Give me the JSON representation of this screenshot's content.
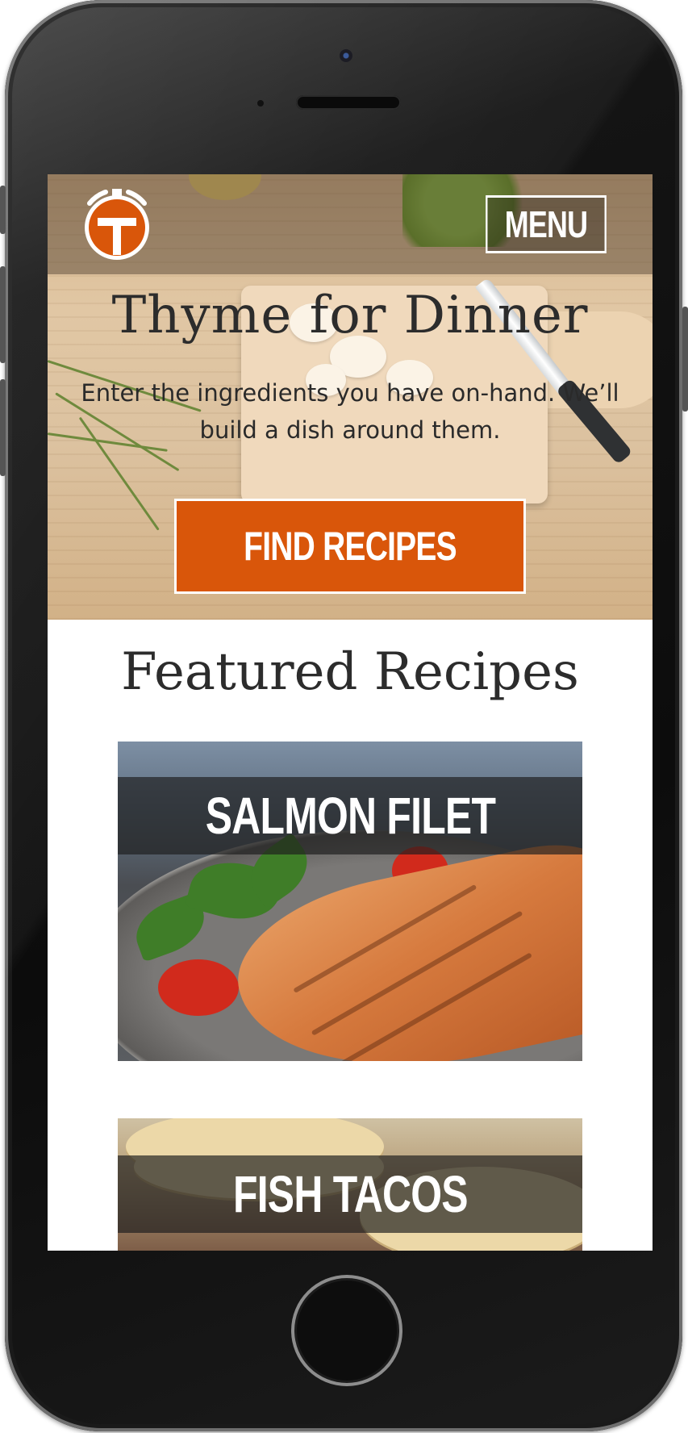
{
  "app": {
    "title": "Thyme for Dinner",
    "subtitle": "Enter the ingredients you have on-hand. We’ll build a dish around them."
  },
  "header": {
    "logo_icon": "thyme-timer-logo-icon",
    "menu_label": "MENU"
  },
  "hero": {
    "cta_label": "FIND RECIPES"
  },
  "featured": {
    "title": "Featured Recipes",
    "recipes": [
      {
        "name": "SALMON FILET"
      },
      {
        "name": "FISH TACOS"
      }
    ]
  },
  "colors": {
    "accent": "#d9560a",
    "text_dark": "#2c2c2c",
    "banner_overlay": "#1e1e1e"
  }
}
